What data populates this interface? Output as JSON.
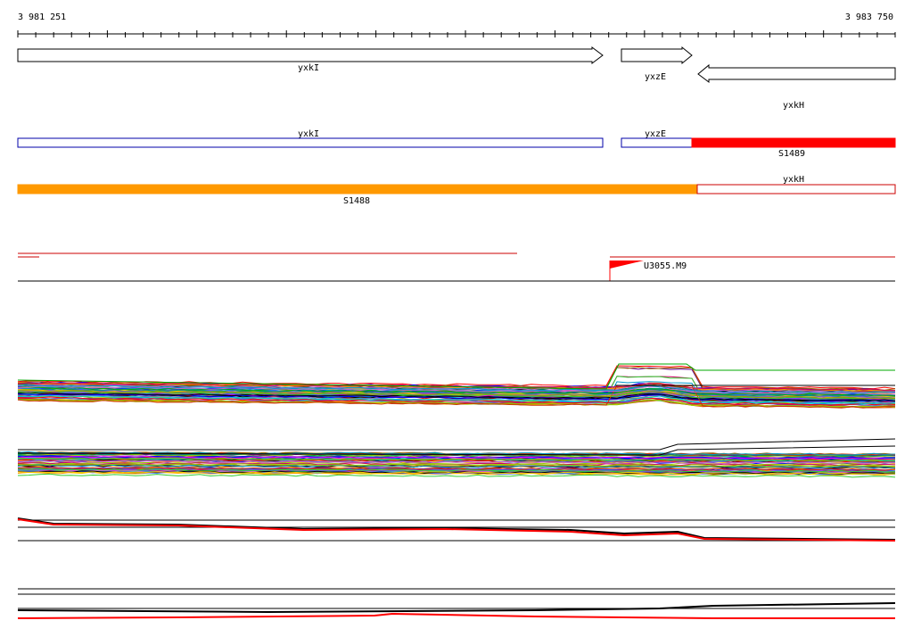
{
  "coords": {
    "start": "3 981 251",
    "end": "3 983 750"
  },
  "genes": [
    {
      "name": "yxkI",
      "strand": "+"
    },
    {
      "name": "yxzE",
      "strand": "+"
    },
    {
      "name": "yxkH",
      "strand": "-"
    }
  ],
  "track2": [
    {
      "label": "yxkI",
      "kind": "gene-box"
    },
    {
      "label": "yxzE",
      "kind": "gene-box"
    },
    {
      "label": "S1489",
      "kind": "segment"
    }
  ],
  "track3": [
    {
      "label": "S1488",
      "kind": "segment"
    },
    {
      "label": "yxkH",
      "kind": "gene-box"
    }
  ],
  "promoter": {
    "label": "U3055.M9"
  },
  "colors": {
    "gene_outline": "#000000",
    "gene_box_plus": "#0000aa",
    "gene_box_minus": "#cc0000",
    "segment_S1489": "#ff0000",
    "segment_S1488": "#ff9900",
    "promoter": "#ff0000",
    "profile_red": "#ff0000",
    "profile_black": "#000000"
  }
}
